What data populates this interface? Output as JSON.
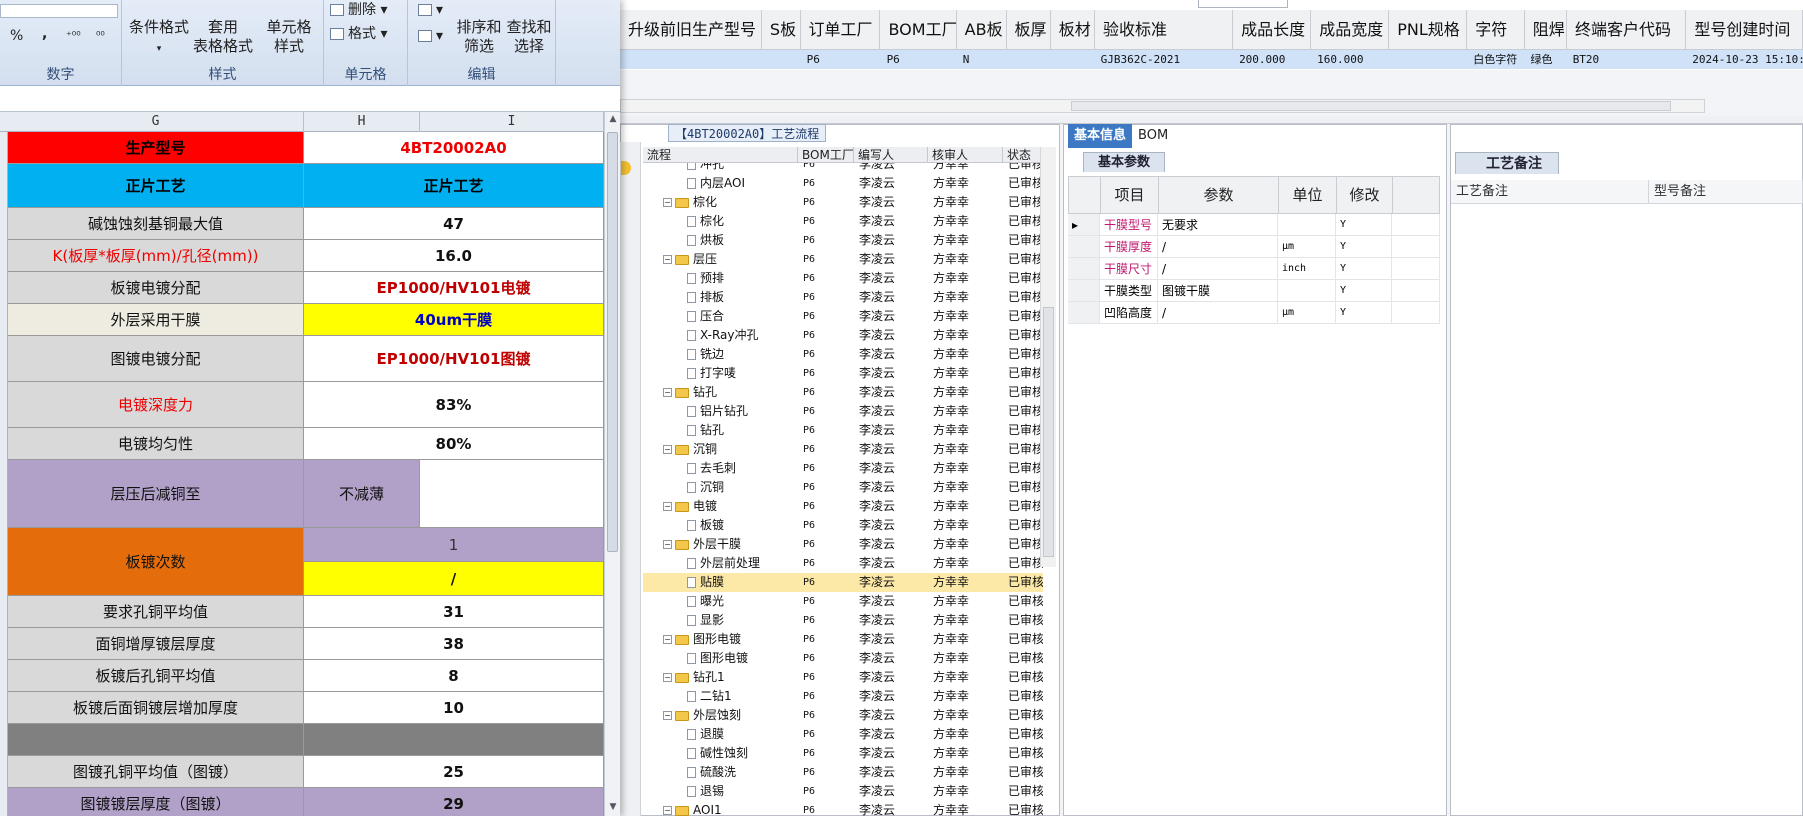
{
  "grid": {
    "headers": [
      "升级前旧生产型号",
      "S板",
      "订单工厂",
      "BOM工厂",
      "AB板",
      "板厚",
      "板材",
      "验收标准",
      "成品长度",
      "成品宽度",
      "PNL规格",
      "字符",
      "阻焊",
      "终端客户代码",
      "型号创建时间"
    ],
    "row": [
      "",
      "",
      "P6",
      "P6",
      "N",
      "",
      "",
      "GJB362C-2021",
      "200.000",
      "160.000",
      "",
      "白色字符",
      "绿色",
      "BT20",
      "2024-10-23 15:10:53"
    ]
  },
  "flow": {
    "tab": "【4BT20002A0】工艺流程",
    "headers": [
      "流程",
      "BOM工厂",
      "编写人",
      "核审人",
      "状态"
    ],
    "rows": [
      {
        "name": "冲孔",
        "level": 2,
        "bom": "P6",
        "writer": "李凌云",
        "reviewer": "方幸幸",
        "status": "已审核"
      },
      {
        "name": "内层AOI",
        "level": 2,
        "bom": "P6",
        "writer": "李凌云",
        "reviewer": "方幸幸",
        "status": "已审核"
      },
      {
        "name": "棕化",
        "level": 1,
        "bom": "P6",
        "writer": "李凌云",
        "reviewer": "方幸幸",
        "status": "已审核"
      },
      {
        "name": "棕化",
        "level": 2,
        "bom": "P6",
        "writer": "李凌云",
        "reviewer": "方幸幸",
        "status": "已审核"
      },
      {
        "name": "烘板",
        "level": 2,
        "bom": "P6",
        "writer": "李凌云",
        "reviewer": "方幸幸",
        "status": "已审核"
      },
      {
        "name": "层压",
        "level": 1,
        "bom": "P6",
        "writer": "李凌云",
        "reviewer": "方幸幸",
        "status": "已审核"
      },
      {
        "name": "预排",
        "level": 2,
        "bom": "P6",
        "writer": "李凌云",
        "reviewer": "方幸幸",
        "status": "已审核"
      },
      {
        "name": "排板",
        "level": 2,
        "bom": "P6",
        "writer": "李凌云",
        "reviewer": "方幸幸",
        "status": "已审核"
      },
      {
        "name": "压合",
        "level": 2,
        "bom": "P6",
        "writer": "李凌云",
        "reviewer": "方幸幸",
        "status": "已审核"
      },
      {
        "name": "X-Ray冲孔",
        "level": 2,
        "bom": "P6",
        "writer": "李凌云",
        "reviewer": "方幸幸",
        "status": "已审核"
      },
      {
        "name": "铣边",
        "level": 2,
        "bom": "P6",
        "writer": "李凌云",
        "reviewer": "方幸幸",
        "status": "已审核"
      },
      {
        "name": "打字唛",
        "level": 2,
        "bom": "P6",
        "writer": "李凌云",
        "reviewer": "方幸幸",
        "status": "已审核"
      },
      {
        "name": "钻孔",
        "level": 1,
        "bom": "P6",
        "writer": "李凌云",
        "reviewer": "方幸幸",
        "status": "已审核"
      },
      {
        "name": "铝片钻孔",
        "level": 2,
        "bom": "P6",
        "writer": "李凌云",
        "reviewer": "方幸幸",
        "status": "已审核"
      },
      {
        "name": "钻孔",
        "level": 2,
        "bom": "P6",
        "writer": "李凌云",
        "reviewer": "方幸幸",
        "status": "已审核"
      },
      {
        "name": "沉铜",
        "level": 1,
        "bom": "P6",
        "writer": "李凌云",
        "reviewer": "方幸幸",
        "status": "已审核"
      },
      {
        "name": "去毛刺",
        "level": 2,
        "bom": "P6",
        "writer": "李凌云",
        "reviewer": "方幸幸",
        "status": "已审核"
      },
      {
        "name": "沉铜",
        "level": 2,
        "bom": "P6",
        "writer": "李凌云",
        "reviewer": "方幸幸",
        "status": "已审核"
      },
      {
        "name": "电镀",
        "level": 1,
        "bom": "P6",
        "writer": "李凌云",
        "reviewer": "方幸幸",
        "status": "已审核"
      },
      {
        "name": "板镀",
        "level": 2,
        "bom": "P6",
        "writer": "李凌云",
        "reviewer": "方幸幸",
        "status": "已审核"
      },
      {
        "name": "外层干膜",
        "level": 1,
        "bom": "P6",
        "writer": "李凌云",
        "reviewer": "方幸幸",
        "status": "已审核"
      },
      {
        "name": "外层前处理",
        "level": 2,
        "bom": "P6",
        "writer": "李凌云",
        "reviewer": "方幸幸",
        "status": "已审核"
      },
      {
        "name": "贴膜",
        "level": 2,
        "bom": "P6",
        "writer": "李凌云",
        "reviewer": "方幸幸",
        "status": "已审核",
        "selected": true
      },
      {
        "name": "曝光",
        "level": 2,
        "bom": "P6",
        "writer": "李凌云",
        "reviewer": "方幸幸",
        "status": "已审核"
      },
      {
        "name": "显影",
        "level": 2,
        "bom": "P6",
        "writer": "李凌云",
        "reviewer": "方幸幸",
        "status": "已审核"
      },
      {
        "name": "图形电镀",
        "level": 1,
        "bom": "P6",
        "writer": "李凌云",
        "reviewer": "方幸幸",
        "status": "已审核"
      },
      {
        "name": "图形电镀",
        "level": 2,
        "bom": "P6",
        "writer": "李凌云",
        "reviewer": "方幸幸",
        "status": "已审核"
      },
      {
        "name": "钻孔1",
        "level": 1,
        "bom": "P6",
        "writer": "李凌云",
        "reviewer": "方幸幸",
        "status": "已审核"
      },
      {
        "name": "二钻1",
        "level": 2,
        "bom": "P6",
        "writer": "李凌云",
        "reviewer": "方幸幸",
        "status": "已审核"
      },
      {
        "name": "外层蚀刻",
        "level": 1,
        "bom": "P6",
        "writer": "李凌云",
        "reviewer": "方幸幸",
        "status": "已审核"
      },
      {
        "name": "退膜",
        "level": 2,
        "bom": "P6",
        "writer": "李凌云",
        "reviewer": "方幸幸",
        "status": "已审核"
      },
      {
        "name": "碱性蚀刻",
        "level": 2,
        "bom": "P6",
        "writer": "李凌云",
        "reviewer": "方幸幸",
        "status": "已审核"
      },
      {
        "name": "硫酸洗",
        "level": 2,
        "bom": "P6",
        "writer": "李凌云",
        "reviewer": "方幸幸",
        "status": "已审核"
      },
      {
        "name": "退锡",
        "level": 2,
        "bom": "P6",
        "writer": "李凌云",
        "reviewer": "方幸幸",
        "status": "已审核"
      },
      {
        "name": "AOI1",
        "level": 1,
        "bom": "P6",
        "writer": "李凌云",
        "reviewer": "方幸幸",
        "status": "已审核"
      }
    ]
  },
  "info": {
    "tabs": [
      "基本信息",
      "BOM"
    ],
    "sub_tab": "基本参数",
    "headers": [
      "项目",
      "参数",
      "单位",
      "修改"
    ],
    "rows": [
      {
        "item": "干膜型号",
        "param": "无要求",
        "unit": "",
        "edit": "Y",
        "pink": true
      },
      {
        "item": "干膜厚度",
        "param": "/",
        "unit": "μm",
        "edit": "Y",
        "pink": true
      },
      {
        "item": "干膜尺寸",
        "param": "/",
        "unit": "inch",
        "edit": "Y",
        "pink": true
      },
      {
        "item": "干膜类型",
        "param": "图镀干膜",
        "unit": "",
        "edit": "Y",
        "pink": false
      },
      {
        "item": "凹陷高度",
        "param": "/",
        "unit": "μm",
        "edit": "Y",
        "pink": false
      }
    ]
  },
  "remark": {
    "tab": "工艺备注",
    "headers": [
      "工艺备注",
      "型号备注"
    ]
  },
  "excel": {
    "ribbon": {
      "number_group_label": "数字",
      "percent": "%",
      "comma": ",",
      "inc_decimal": "⁺⁰⁰",
      "dec_decimal": "⁰⁰",
      "styles_group_label": "样式",
      "cond_format": "条件格式",
      "table_format": "套用\n表格格式",
      "cell_styles": "单元格\n样式",
      "cells_group_label": "单元格",
      "delete": "删除",
      "format": "格式",
      "edit_group_label": "编辑",
      "sort_filter": "排序和\n筛选",
      "find_select": "查找和\n选择"
    },
    "columns": [
      "G",
      "H",
      "I"
    ],
    "cells": {
      "model_label": "生产型号",
      "model_value": "4BT20002A0",
      "front_process_l": "正片工艺",
      "front_process_r": "正片工艺",
      "etch_max_label": "碱蚀蚀刻基铜最大值",
      "etch_max_value": "47",
      "k_label": "K(板厚*板厚(mm)/孔径(mm))",
      "k_value": "16.0",
      "panel_plating_label": "板镀电镀分配",
      "panel_plating_value": "EP1000/HV101电镀",
      "outer_film_label": "外层采用干膜",
      "outer_film_value": "40um干膜",
      "pattern_plating_label": "图镀电镀分配",
      "pattern_plating_value": "EP1000/HV101图镀",
      "throw_label": "电镀深度力",
      "throw_value": "83%",
      "uniform_label": "电镀均匀性",
      "uniform_value": "80%",
      "lam_reduce_label": "层压后减铜至",
      "lam_reduce_value": "不减薄",
      "plating_times_label": "板镀次数",
      "plating_times_1": "1",
      "plating_times_2": "/",
      "hole_avg_label": "要求孔铜平均值",
      "hole_avg_value": "31",
      "surface_label": "面铜增厚镀层厚度",
      "surface_value": "38",
      "after_hole_label": "板镀后孔铜平均值",
      "after_hole_value": "8",
      "after_surface_label": "板镀后面铜镀层增加厚度",
      "after_surface_value": "10",
      "pattern_hole_label": "图镀孔铜平均值（图镀）",
      "pattern_hole_value": "25",
      "pattern_thick_label": "图镀镀层厚度（图镀）",
      "pattern_thick_value": "29"
    }
  },
  "colors": {
    "red": "#ff0000",
    "cyan": "#00b0f0",
    "yellow": "#ffff00",
    "orange": "#e46c0a",
    "lavender": "#b1a0c7",
    "gray": "#d9d9d9",
    "darkgray": "#808080"
  }
}
